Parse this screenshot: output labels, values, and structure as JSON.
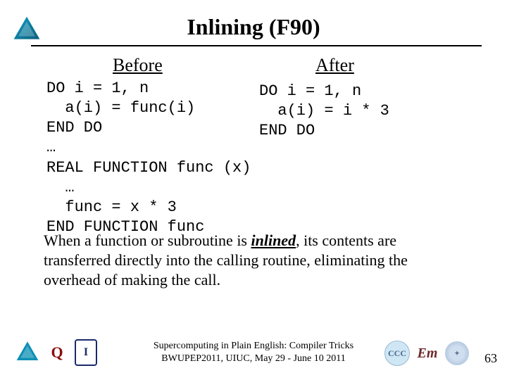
{
  "title": "Inlining (F90)",
  "columns": {
    "before": "Before",
    "after": "After"
  },
  "code_before": "DO i = 1, n\n  a(i) = func(i)\nEND DO\n…\nREAL FUNCTION func (x)\n  …\n  func = x * 3\nEND FUNCTION func",
  "code_after": "DO i = 1, n\n  a(i) = i * 3\nEND DO",
  "explain_pre": "When a function or subroutine is ",
  "explain_term": "inlined",
  "explain_post": ", its contents are transferred directly into the calling routine, eliminating the overhead of making the call.",
  "footer": {
    "line1": "Supercomputing in Plain English: Compiler Tricks",
    "line2": "BWUPEP2011, UIUC, May 29 - June 10 2011"
  },
  "page_number": "63",
  "logos": {
    "ou": "Q",
    "illinois": "I",
    "ccc": "CCC",
    "ec": "Eт",
    "seal": "✦"
  }
}
